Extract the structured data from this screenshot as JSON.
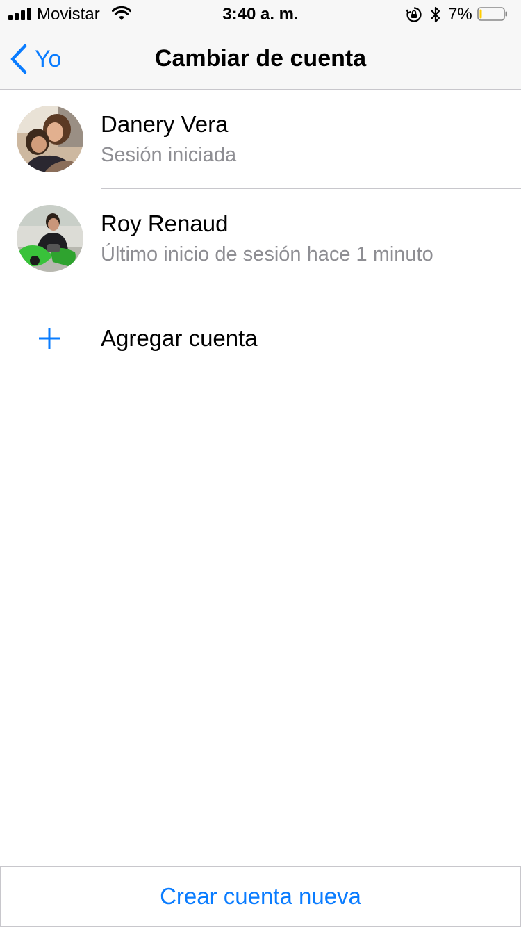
{
  "status_bar": {
    "carrier": "Movistar",
    "time": "3:40 a. m.",
    "battery_percent": "7%",
    "battery_level": 0.07,
    "battery_color": "#ffcc00",
    "icons": [
      "signal-icon",
      "wifi-icon",
      "rotation-lock-icon",
      "bluetooth-icon",
      "battery-icon"
    ]
  },
  "nav": {
    "back_label": "Yo",
    "title": "Cambiar de cuenta",
    "accent_color": "#0a7cff"
  },
  "accounts": [
    {
      "name": "Danery Vera",
      "status": "Sesión iniciada",
      "avatar": "profile-photo"
    },
    {
      "name": "Roy Renaud",
      "status": "Último inicio de sesión hace 1 minuto",
      "avatar": "profile-photo"
    }
  ],
  "add_account": {
    "label": "Agregar cuenta",
    "icon": "plus-icon"
  },
  "footer": {
    "create_label": "Crear cuenta nueva"
  }
}
